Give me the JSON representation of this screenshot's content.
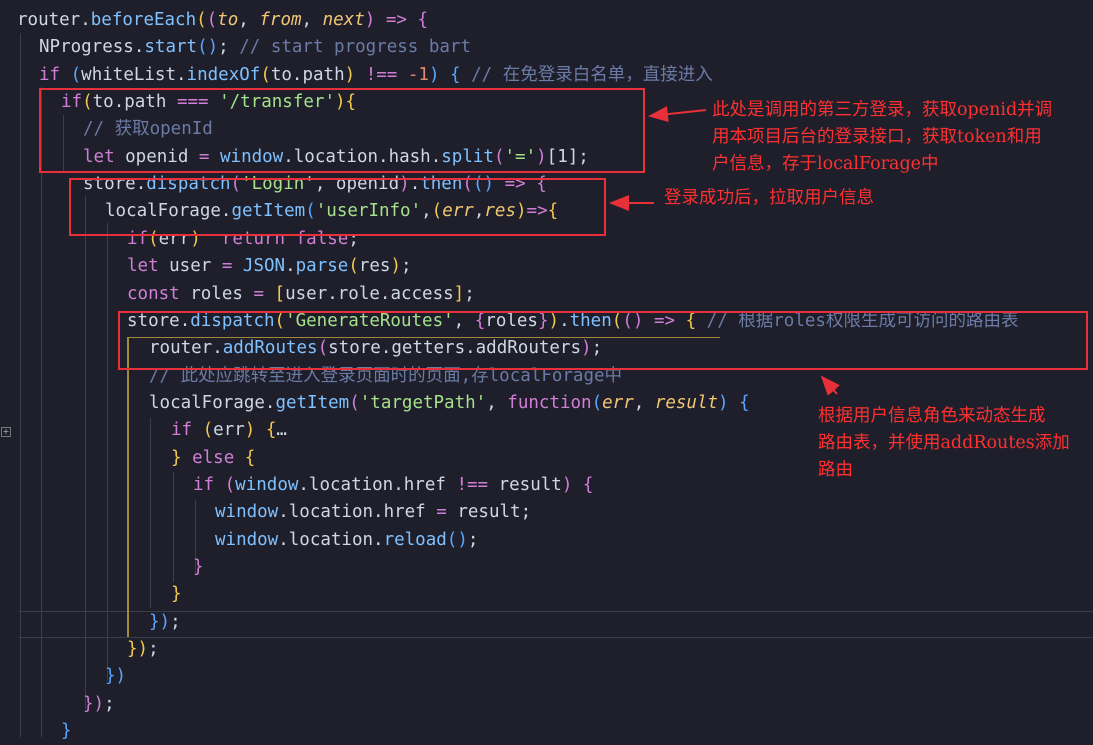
{
  "editor": {
    "lines": [
      [
        [
          "router",
          "cn"
        ],
        [
          ".",
          "cn"
        ],
        [
          "beforeEach",
          "f"
        ],
        [
          "(",
          "b1"
        ],
        [
          "(",
          "b2"
        ],
        [
          "to",
          "p"
        ],
        [
          ", ",
          "cn"
        ],
        [
          "from",
          "p"
        ],
        [
          ", ",
          "cn"
        ],
        [
          "next",
          "p"
        ],
        [
          ")",
          "b2"
        ],
        [
          " ",
          "cn"
        ],
        [
          "=>",
          "k"
        ],
        [
          " ",
          "cn"
        ],
        [
          "{",
          "b2"
        ]
      ],
      [
        [
          "NProgress",
          "cn"
        ],
        [
          ".",
          "cn"
        ],
        [
          "start",
          "f"
        ],
        [
          "()",
          "b3"
        ],
        [
          "; ",
          "cn"
        ],
        [
          "// start progress bart",
          "c"
        ]
      ],
      [
        [
          "if",
          "k"
        ],
        [
          " ",
          "cn"
        ],
        [
          "(",
          "b3"
        ],
        [
          "whiteList",
          "cn"
        ],
        [
          ".",
          "cn"
        ],
        [
          "indexOf",
          "f"
        ],
        [
          "(",
          "b1"
        ],
        [
          "to.path",
          "cn"
        ],
        [
          ")",
          "b1"
        ],
        [
          " ",
          "cn"
        ],
        [
          "!==",
          "k"
        ],
        [
          " ",
          "cn"
        ],
        [
          "-1",
          "n"
        ],
        [
          ")",
          "b3"
        ],
        [
          " ",
          "cn"
        ],
        [
          "{",
          "b3"
        ],
        [
          " ",
          "cn"
        ],
        [
          "// 在免登录白名单，直接进入",
          "c"
        ]
      ],
      [
        [
          "if",
          "k"
        ],
        [
          "(",
          "b1"
        ],
        [
          "to.path",
          "cn"
        ],
        [
          " ",
          "cn"
        ],
        [
          "===",
          "k"
        ],
        [
          " ",
          "cn"
        ],
        [
          "'/transfer'",
          "s"
        ],
        [
          ")",
          "b1"
        ],
        [
          "{",
          "b1"
        ]
      ],
      [
        [
          "// 获取openId",
          "c"
        ]
      ],
      [
        [
          "let",
          "k"
        ],
        [
          " openid ",
          "cn"
        ],
        [
          "=",
          "k"
        ],
        [
          " ",
          "cn"
        ],
        [
          "window",
          "f"
        ],
        [
          ".location.hash.",
          "cn"
        ],
        [
          "split",
          "f"
        ],
        [
          "(",
          "b2"
        ],
        [
          "'='",
          "s"
        ],
        [
          ")",
          "b2"
        ],
        [
          "[1]",
          "cn"
        ],
        [
          ";",
          "cn"
        ]
      ],
      [
        [
          "store",
          "cn"
        ],
        [
          ".",
          "cn"
        ],
        [
          "dispatch",
          "f"
        ],
        [
          "(",
          "b2"
        ],
        [
          "'Login'",
          "s"
        ],
        [
          ", openid",
          "cn"
        ],
        [
          ")",
          "b2"
        ],
        [
          ".",
          "cn"
        ],
        [
          "then",
          "f"
        ],
        [
          "(",
          "b2"
        ],
        [
          "()",
          "b3"
        ],
        [
          " ",
          "cn"
        ],
        [
          "=>",
          "k"
        ],
        [
          " ",
          "cn"
        ],
        [
          "{",
          "b2"
        ]
      ],
      [
        [
          "localForage",
          "cn"
        ],
        [
          ".",
          "cn"
        ],
        [
          "getItem",
          "f"
        ],
        [
          "(",
          "b3"
        ],
        [
          "'userInfo'",
          "s"
        ],
        [
          ",",
          "cn"
        ],
        [
          "(",
          "b1"
        ],
        [
          "err",
          "p"
        ],
        [
          ",",
          "cn"
        ],
        [
          "res",
          "p"
        ],
        [
          ")",
          "b1"
        ],
        [
          "=>",
          "k"
        ],
        [
          "{",
          "b1"
        ]
      ],
      [
        [
          "if",
          "k"
        ],
        [
          "(",
          "b1"
        ],
        [
          "err",
          "cn"
        ],
        [
          ")",
          "b1"
        ],
        [
          "  ",
          "cn"
        ],
        [
          "return",
          "k"
        ],
        [
          " ",
          "cn"
        ],
        [
          "false",
          "k"
        ],
        [
          ";",
          "cn"
        ]
      ],
      [
        [
          "let",
          "k"
        ],
        [
          " user ",
          "cn"
        ],
        [
          "=",
          "k"
        ],
        [
          " ",
          "cn"
        ],
        [
          "JSON",
          "f"
        ],
        [
          ".",
          "cn"
        ],
        [
          "parse",
          "f"
        ],
        [
          "(",
          "b1"
        ],
        [
          "res",
          "cn"
        ],
        [
          ")",
          "b1"
        ],
        [
          ";",
          "cn"
        ]
      ],
      [
        [
          "const",
          "k"
        ],
        [
          " roles ",
          "cn"
        ],
        [
          "=",
          "k"
        ],
        [
          " ",
          "cn"
        ],
        [
          "[",
          "b1"
        ],
        [
          "user.role.access",
          "cn"
        ],
        [
          "]",
          "b1"
        ],
        [
          ";",
          "cn"
        ]
      ],
      [
        [
          "store",
          "cn"
        ],
        [
          ".",
          "cn"
        ],
        [
          "dispatch",
          "f"
        ],
        [
          "(",
          "b1"
        ],
        [
          "'GenerateRoutes'",
          "s"
        ],
        [
          ", ",
          "cn"
        ],
        [
          "{",
          "b2"
        ],
        [
          "roles",
          "cn"
        ],
        [
          "}",
          "b2"
        ],
        [
          ")",
          "b1"
        ],
        [
          ".",
          "cn"
        ],
        [
          "then",
          "f"
        ],
        [
          "(",
          "b1"
        ],
        [
          "()",
          "b2"
        ],
        [
          " ",
          "cn"
        ],
        [
          "=>",
          "k"
        ],
        [
          " ",
          "cn"
        ],
        [
          "{",
          "b1"
        ],
        [
          " ",
          "cn"
        ],
        [
          "// 根据roles权限生成可访问的路由表",
          "c"
        ]
      ],
      [
        [
          "router",
          "cn"
        ],
        [
          ".",
          "cn"
        ],
        [
          "addRoutes",
          "f"
        ],
        [
          "(",
          "b2"
        ],
        [
          "store.getters.addRouters",
          "cn"
        ],
        [
          ")",
          "b2"
        ],
        [
          ";",
          "cn"
        ]
      ],
      [
        [
          "// 此处应跳转至进入登录页面时的页面,存localForage中",
          "c"
        ]
      ],
      [
        [
          "localForage",
          "cn"
        ],
        [
          ".",
          "cn"
        ],
        [
          "getItem",
          "f"
        ],
        [
          "(",
          "b2"
        ],
        [
          "'targetPath'",
          "s"
        ],
        [
          ", ",
          "cn"
        ],
        [
          "function",
          "k"
        ],
        [
          "(",
          "b3"
        ],
        [
          "err",
          "p"
        ],
        [
          ", ",
          "cn"
        ],
        [
          "result",
          "p"
        ],
        [
          ")",
          "b3"
        ],
        [
          " ",
          "cn"
        ],
        [
          "{",
          "b3"
        ]
      ],
      [
        [
          "if",
          "k"
        ],
        [
          " ",
          "cn"
        ],
        [
          "(",
          "b1"
        ],
        [
          "err",
          "cn"
        ],
        [
          ")",
          "b1"
        ],
        [
          " ",
          "cn"
        ],
        [
          "{",
          "b1"
        ],
        [
          "…",
          "cn"
        ]
      ],
      [
        [
          "}",
          "b1"
        ],
        [
          " ",
          "cn"
        ],
        [
          "else",
          "k"
        ],
        [
          " ",
          "cn"
        ],
        [
          "{",
          "b1"
        ]
      ],
      [
        [
          "if",
          "k"
        ],
        [
          " ",
          "cn"
        ],
        [
          "(",
          "b2"
        ],
        [
          "window",
          "f"
        ],
        [
          ".location.href ",
          "cn"
        ],
        [
          "!==",
          "k"
        ],
        [
          " result",
          "cn"
        ],
        [
          ")",
          "b2"
        ],
        [
          " ",
          "cn"
        ],
        [
          "{",
          "b2"
        ]
      ],
      [
        [
          "window",
          "f"
        ],
        [
          ".location.href ",
          "cn"
        ],
        [
          "=",
          "k"
        ],
        [
          " result;",
          "cn"
        ]
      ],
      [
        [
          "window",
          "f"
        ],
        [
          ".location.",
          "cn"
        ],
        [
          "reload",
          "f"
        ],
        [
          "()",
          "b3"
        ],
        [
          ";",
          "cn"
        ]
      ],
      [
        [
          "}",
          "b2"
        ]
      ],
      [
        [
          "}",
          "b1"
        ]
      ],
      [
        [
          "}",
          "b3"
        ],
        [
          ")",
          "b3"
        ],
        [
          ";",
          "cn"
        ]
      ],
      [
        [
          "}",
          "b1"
        ],
        [
          ")",
          "b1"
        ],
        [
          ";",
          "cn"
        ]
      ],
      [
        [
          "}",
          "b3"
        ],
        [
          ")",
          "b3"
        ]
      ],
      [
        [
          "}",
          "b2"
        ],
        [
          ")",
          "b2"
        ],
        [
          ";",
          "cn"
        ]
      ],
      [
        [
          "}",
          "b3"
        ]
      ]
    ]
  },
  "annotations": {
    "note1": [
      "此处是调用的第三方登录，获取openid并调",
      "用本项目后台的登录接口，获取token和用",
      "户信息，存于localForage中"
    ],
    "note2": [
      "登录成功后，拉取用户信息"
    ],
    "note3": [
      "根据用户信息角色来动态生成",
      "路由表，并使用addRoutes添加",
      "路由"
    ]
  },
  "colors": {
    "background": "#1e1f2b",
    "annotation_red": "#e8303a"
  }
}
